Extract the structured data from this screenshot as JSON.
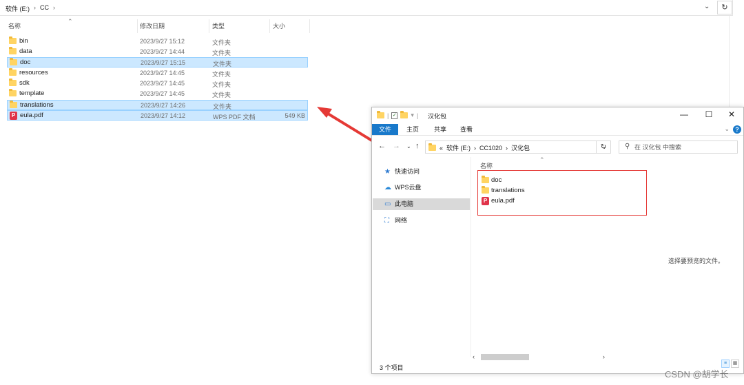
{
  "main": {
    "breadcrumb": [
      "软件 (E:)",
      "CC"
    ],
    "columns": {
      "name": "名称",
      "date": "修改日期",
      "type": "类型",
      "size": "大小"
    },
    "rows": [
      {
        "name": "bin",
        "date": "2023/9/27 15:12",
        "type": "文件夹",
        "size": "",
        "icon": "folder-icon",
        "selected": false
      },
      {
        "name": "data",
        "date": "2023/9/27 14:44",
        "type": "文件夹",
        "size": "",
        "icon": "folder-icon",
        "selected": false
      },
      {
        "name": "doc",
        "date": "2023/9/27 15:15",
        "type": "文件夹",
        "size": "",
        "icon": "folder-icon",
        "selected": true
      },
      {
        "name": "resources",
        "date": "2023/9/27 14:45",
        "type": "文件夹",
        "size": "",
        "icon": "folder-icon",
        "selected": false
      },
      {
        "name": "sdk",
        "date": "2023/9/27 14:45",
        "type": "文件夹",
        "size": "",
        "icon": "folder-icon",
        "selected": false
      },
      {
        "name": "template",
        "date": "2023/9/27 14:45",
        "type": "文件夹",
        "size": "",
        "icon": "folder-icon",
        "selected": false
      },
      {
        "name": "translations",
        "date": "2023/9/27 14:26",
        "type": "文件夹",
        "size": "",
        "icon": "folder-icon",
        "selected": true
      },
      {
        "name": "eula.pdf",
        "date": "2023/9/27 14:12",
        "type": "WPS PDF 文档",
        "size": "549 KB",
        "icon": "pdf-icon",
        "selected": true
      }
    ]
  },
  "window": {
    "title": "汉化包",
    "ribbon_tabs": [
      "文件",
      "主页",
      "共享",
      "查看"
    ],
    "address": [
      "«",
      "软件 (E:)",
      "CC1020",
      "汉化包"
    ],
    "search_placeholder": "在 汉化包 中搜索",
    "nav_items": [
      {
        "label": "快速访问",
        "icon": "star-icon",
        "selected": false
      },
      {
        "label": "WPS云盘",
        "icon": "cloud-icon",
        "selected": false
      },
      {
        "label": "此电脑",
        "icon": "computer-icon",
        "selected": true
      },
      {
        "label": "网络",
        "icon": "network-icon",
        "selected": false
      }
    ],
    "content_header": "名称",
    "items": [
      {
        "name": "doc",
        "icon": "folder-icon"
      },
      {
        "name": "translations",
        "icon": "folder-icon"
      },
      {
        "name": "eula.pdf",
        "icon": "pdf-icon"
      }
    ],
    "preview_text": "选择要预览的文件。",
    "status_text": "3 个项目"
  },
  "watermark": "CSDN @胡学长",
  "colors": {
    "selection": "#cce8ff",
    "selection_border": "#99d1ff",
    "accent": "#1979ca",
    "annotation": "#e53935"
  }
}
